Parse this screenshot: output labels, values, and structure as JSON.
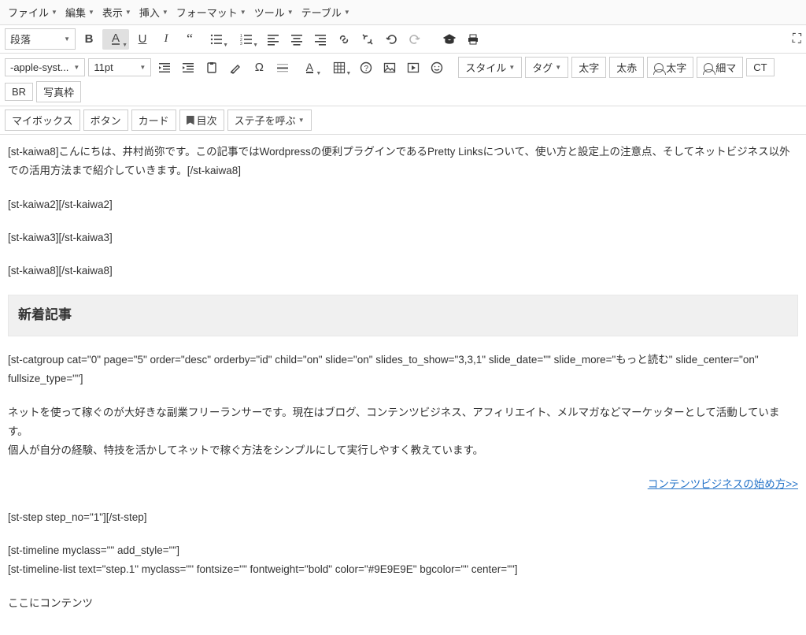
{
  "menu": [
    "ファイル",
    "編集",
    "表示",
    "挿入",
    "フォーマット",
    "ツール",
    "テーブル"
  ],
  "row1": {
    "format_select": "段落",
    "dropdowns": {
      "style": "スタイル",
      "tag": "タグ"
    },
    "pills": [
      "太字",
      "太赤",
      "太字",
      "細マ",
      "CT",
      "BR",
      "写真枠"
    ]
  },
  "row2": {
    "font_select": "-apple-syst...",
    "size_select": "11pt",
    "pills": [
      "マイボックス",
      "ボタン",
      "カード",
      "目次",
      "ステ子を呼ぶ"
    ]
  },
  "content": {
    "p1": "[st-kaiwa8]こんにちは、井村尚弥です。この記事ではWordpressの便利プラグインであるPretty Linksについて、使い方と設定上の注意点、そしてネットビジネス以外での活用方法まで紹介していきます。[/st-kaiwa8]",
    "p2": "[st-kaiwa2][/st-kaiwa2]",
    "p3": "[st-kaiwa3][/st-kaiwa3]",
    "p4": "[st-kaiwa8][/st-kaiwa8]",
    "h2": "新着記事",
    "p5": "[st-catgroup cat=\"0\" page=\"5\" order=\"desc\" orderby=\"id\" child=\"on\" slide=\"on\" slides_to_show=\"3,3,1\" slide_date=\"\" slide_more=\"もっと読む\" slide_center=\"on\" fullsize_type=\"\"]",
    "p6a": "ネットを使って稼ぐのが大好きな副業フリーランサーです。現在はブログ、コンテンツビジネス、アフィリエイト、メルマガなどマーケッターとして活動しています。",
    "p6b": "個人が自分の経験、特技を活かしてネットで稼ぐ方法をシンプルにして実行しやすく教えています。",
    "link": "コンテンツビジネスの始め方>>",
    "p7": "[st-step step_no=\"1\"][/st-step]",
    "p8a": "[st-timeline myclass=\"\" add_style=\"\"]",
    "p8b": "[st-timeline-list text=\"step.1\" myclass=\"\" fontsize=\"\" fontweight=\"bold\" color=\"#9E9E9E\" bgcolor=\"\" center=\"\"]",
    "p9": "ここにコンテンツ"
  }
}
